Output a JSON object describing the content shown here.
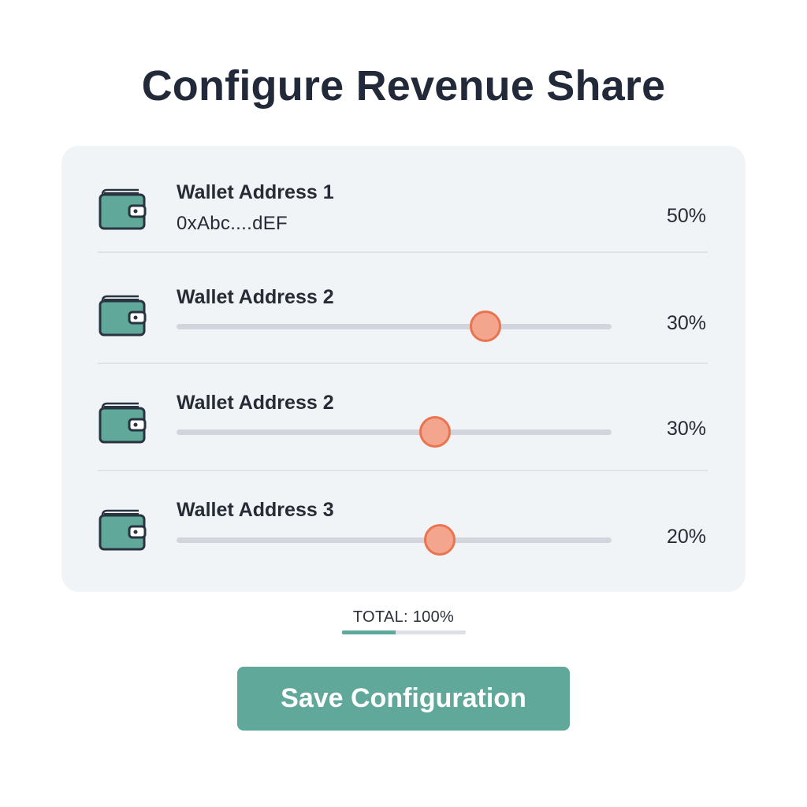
{
  "header": {
    "title": "Configure Revenue Share"
  },
  "wallets": [
    {
      "label": "Wallet Address 1",
      "address": "0xAbc....dEF",
      "percent_text": "50%",
      "slider_position": null
    },
    {
      "label": "Wallet Address 2",
      "address": "",
      "percent_text": "30%",
      "slider_position": 0.71
    },
    {
      "label": "Wallet Address 2",
      "address": "",
      "percent_text": "30%",
      "slider_position": 0.595
    },
    {
      "label": "Wallet Address 3",
      "address": "",
      "percent_text": "20%",
      "slider_position": 0.605
    }
  ],
  "summary": {
    "total_text": "TOTAL: 100%",
    "total_bar_fill": 0.43
  },
  "actions": {
    "save_label": "Save Configuration"
  },
  "icons": {
    "wallet": "wallet-icon"
  },
  "colors": {
    "accent": "#5fa89a",
    "slider_thumb": "#f4a58d",
    "slider_thumb_border": "#ea7450",
    "panel_background": "#f1f4f7",
    "title_text": "#222a3a"
  }
}
